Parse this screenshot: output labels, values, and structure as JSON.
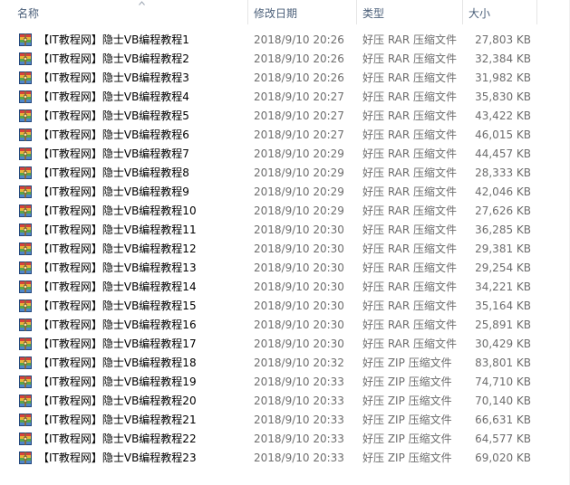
{
  "columns": {
    "name": "名称",
    "date": "修改日期",
    "type": "类型",
    "size": "大小"
  },
  "icons": {
    "sort": "sort-ascending-icon",
    "file": "archive-file-icon"
  },
  "colors": {
    "header_text": "#4c607a",
    "date_text": "#6d6d6d"
  },
  "files": [
    {
      "name": "【IT教程网】隐士VB编程教程1",
      "date": "2018/9/10 20:26",
      "type": "好压 RAR 压缩文件",
      "size": "27,803 KB"
    },
    {
      "name": "【IT教程网】隐士VB编程教程2",
      "date": "2018/9/10 20:26",
      "type": "好压 RAR 压缩文件",
      "size": "32,384 KB"
    },
    {
      "name": "【IT教程网】隐士VB编程教程3",
      "date": "2018/9/10 20:26",
      "type": "好压 RAR 压缩文件",
      "size": "31,982 KB"
    },
    {
      "name": "【IT教程网】隐士VB编程教程4",
      "date": "2018/9/10 20:27",
      "type": "好压 RAR 压缩文件",
      "size": "35,830 KB"
    },
    {
      "name": "【IT教程网】隐士VB编程教程5",
      "date": "2018/9/10 20:27",
      "type": "好压 RAR 压缩文件",
      "size": "43,422 KB"
    },
    {
      "name": "【IT教程网】隐士VB编程教程6",
      "date": "2018/9/10 20:27",
      "type": "好压 RAR 压缩文件",
      "size": "46,015 KB"
    },
    {
      "name": "【IT教程网】隐士VB编程教程7",
      "date": "2018/9/10 20:29",
      "type": "好压 RAR 压缩文件",
      "size": "44,457 KB"
    },
    {
      "name": "【IT教程网】隐士VB编程教程8",
      "date": "2018/9/10 20:29",
      "type": "好压 RAR 压缩文件",
      "size": "28,333 KB"
    },
    {
      "name": "【IT教程网】隐士VB编程教程9",
      "date": "2018/9/10 20:29",
      "type": "好压 RAR 压缩文件",
      "size": "42,046 KB"
    },
    {
      "name": "【IT教程网】隐士VB编程教程10",
      "date": "2018/9/10 20:29",
      "type": "好压 RAR 压缩文件",
      "size": "27,626 KB"
    },
    {
      "name": "【IT教程网】隐士VB编程教程11",
      "date": "2018/9/10 20:30",
      "type": "好压 RAR 压缩文件",
      "size": "36,285 KB"
    },
    {
      "name": "【IT教程网】隐士VB编程教程12",
      "date": "2018/9/10 20:30",
      "type": "好压 RAR 压缩文件",
      "size": "29,381 KB"
    },
    {
      "name": "【IT教程网】隐士VB编程教程13",
      "date": "2018/9/10 20:30",
      "type": "好压 RAR 压缩文件",
      "size": "29,254 KB"
    },
    {
      "name": "【IT教程网】隐士VB编程教程14",
      "date": "2018/9/10 20:30",
      "type": "好压 RAR 压缩文件",
      "size": "34,221 KB"
    },
    {
      "name": "【IT教程网】隐士VB编程教程15",
      "date": "2018/9/10 20:30",
      "type": "好压 RAR 压缩文件",
      "size": "35,164 KB"
    },
    {
      "name": "【IT教程网】隐士VB编程教程16",
      "date": "2018/9/10 20:30",
      "type": "好压 RAR 压缩文件",
      "size": "25,891 KB"
    },
    {
      "name": "【IT教程网】隐士VB编程教程17",
      "date": "2018/9/10 20:30",
      "type": "好压 RAR 压缩文件",
      "size": "30,429 KB"
    },
    {
      "name": "【IT教程网】隐士VB编程教程18",
      "date": "2018/9/10 20:32",
      "type": "好压 ZIP 压缩文件",
      "size": "83,801 KB"
    },
    {
      "name": "【IT教程网】隐士VB编程教程19",
      "date": "2018/9/10 20:33",
      "type": "好压 ZIP 压缩文件",
      "size": "74,710 KB"
    },
    {
      "name": "【IT教程网】隐士VB编程教程20",
      "date": "2018/9/10 20:33",
      "type": "好压 ZIP 压缩文件",
      "size": "70,140 KB"
    },
    {
      "name": "【IT教程网】隐士VB编程教程21",
      "date": "2018/9/10 20:33",
      "type": "好压 ZIP 压缩文件",
      "size": "66,631 KB"
    },
    {
      "name": "【IT教程网】隐士VB编程教程22",
      "date": "2018/9/10 20:33",
      "type": "好压 ZIP 压缩文件",
      "size": "64,577 KB"
    },
    {
      "name": "【IT教程网】隐士VB编程教程23",
      "date": "2018/9/10 20:33",
      "type": "好压 ZIP 压缩文件",
      "size": "69,020 KB"
    }
  ]
}
